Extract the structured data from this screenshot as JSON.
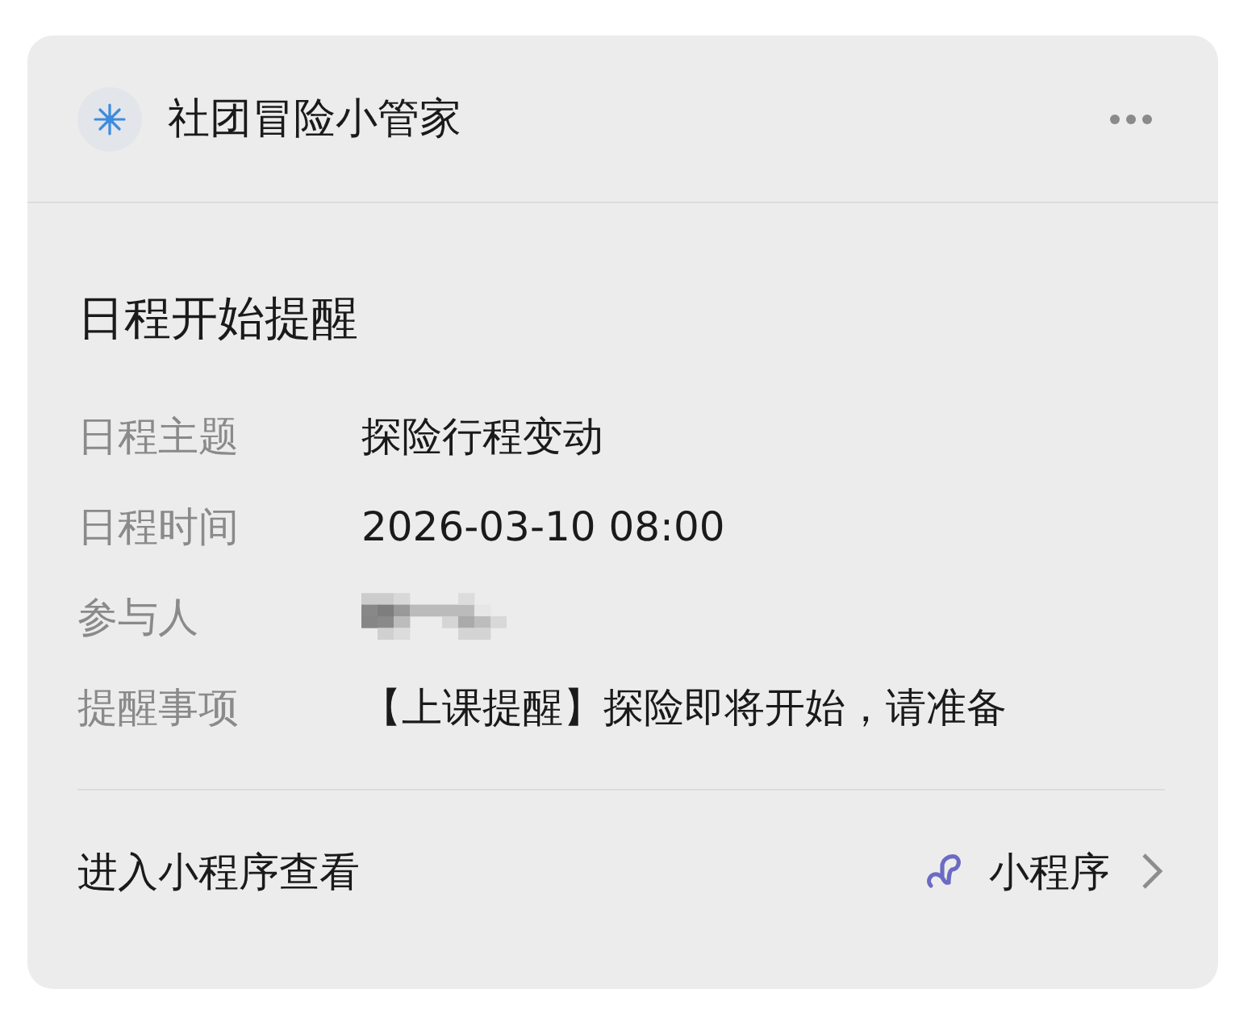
{
  "header": {
    "title": "社团冒险小管家"
  },
  "card": {
    "title": "日程开始提醒",
    "fields": [
      {
        "label": "日程主题",
        "value": "探险行程变动",
        "kind": "text"
      },
      {
        "label": "日程时间",
        "value": "2026-03-10 08:00",
        "kind": "text"
      },
      {
        "label": "参与人",
        "kind": "redacted"
      },
      {
        "label": "提醒事项",
        "value": "【上课提醒】探险即将开始，请准备",
        "kind": "text"
      }
    ]
  },
  "footer": {
    "link": "进入小程序查看",
    "badge": "小程序"
  }
}
